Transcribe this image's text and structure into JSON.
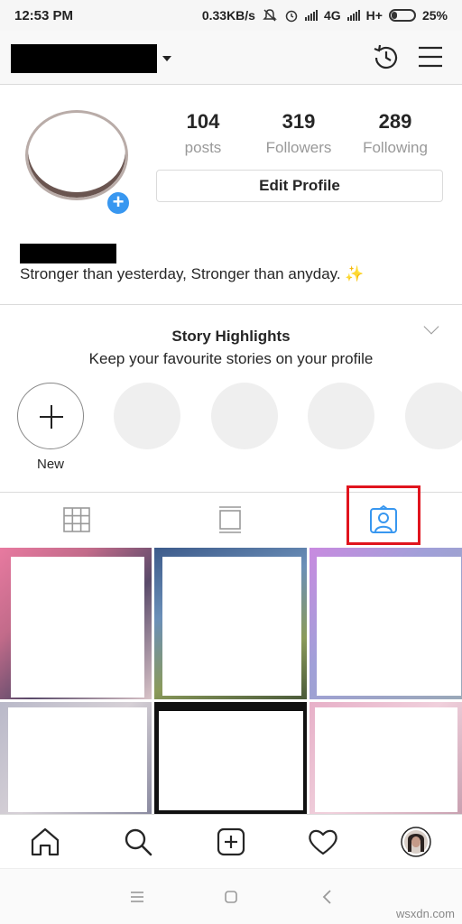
{
  "status": {
    "time": "12:53 PM",
    "speed": "0.33KB/s",
    "network": "4G",
    "network2": "H+",
    "battery": "25%"
  },
  "topbar": {
    "username_redacted": true,
    "icons": [
      "archive-history-icon",
      "menu-icon"
    ]
  },
  "profile": {
    "stats": [
      {
        "value": "104",
        "label": "posts"
      },
      {
        "value": "319",
        "label": "Followers"
      },
      {
        "value": "289",
        "label": "Following"
      }
    ],
    "edit_button": "Edit Profile",
    "bio": "Stronger than yesterday, Stronger than anyday.",
    "bio_emoji": "✨"
  },
  "highlights": {
    "title": "Story Highlights",
    "subtitle": "Keep your favourite stories on your profile",
    "new_label": "New"
  },
  "tabs": {
    "items": [
      "grid-icon",
      "feed-icon",
      "tagged-icon"
    ],
    "active": "tagged-icon",
    "active_color": "#3897f0",
    "highlight_color": "#e0141e"
  },
  "bottom_nav": {
    "items": [
      "home-icon",
      "search-icon",
      "add-post-icon",
      "activity-heart-icon",
      "profile-avatar"
    ]
  },
  "watermark": "wsxdn.com"
}
